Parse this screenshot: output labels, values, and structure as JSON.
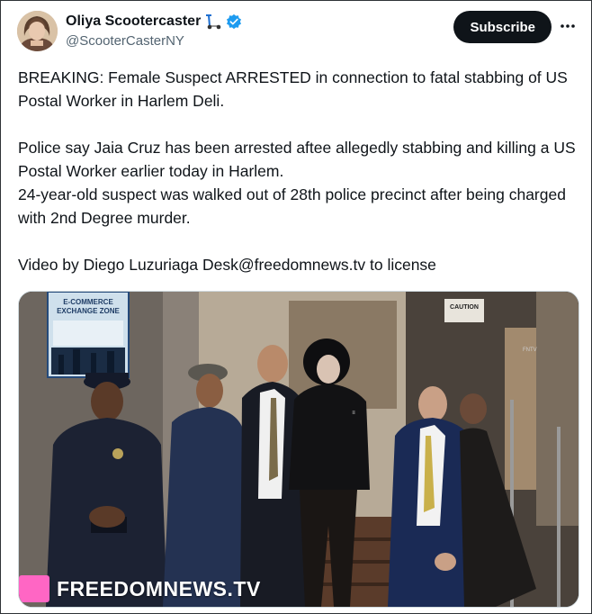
{
  "author": {
    "display_name": "Oliya Scootercaster",
    "handle": "@ScooterCasterNY",
    "verified": true,
    "emoji_icon": "kick-scooter-icon"
  },
  "actions": {
    "subscribe_label": "Subscribe",
    "more_icon": "more-icon"
  },
  "tweet": {
    "line1": "BREAKING: Female Suspect ARRESTED in connection to fatal stabbing of US Postal Worker in Harlem Deli.",
    "line2": "Police say Jaia Cruz has been arrested aftee allegedly stabbing and killing a US Postal Worker earlier today in Harlem.",
    "line3": "24-year-old  suspect was walked out of 28th police precinct after being charged with 2nd Degree murder.",
    "line4": "Video by Diego Luzuriaga Desk@freedomnews.tv to license"
  },
  "media": {
    "sign_line1": "E-COMMERCE",
    "sign_line2": "EXCHANGE ZONE",
    "caution_label": "CAUTION",
    "watermark": "FREEDOMNEWS.TV"
  },
  "colors": {
    "accent": "#1d9bf0",
    "watermark_logo": "#ff66c4"
  }
}
